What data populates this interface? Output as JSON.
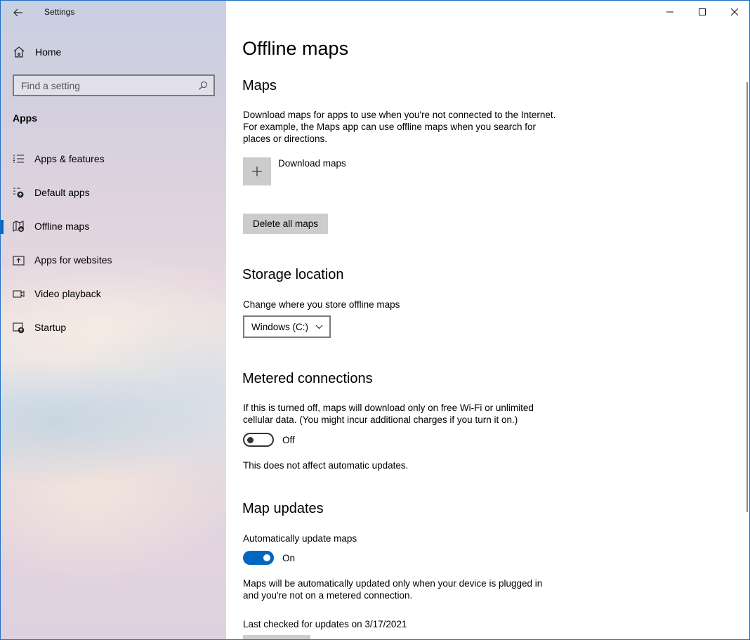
{
  "window": {
    "title": "Settings",
    "accent": "#0067c0"
  },
  "sidebar": {
    "home_label": "Home",
    "search_placeholder": "Find a setting",
    "section_label": "Apps",
    "items": [
      {
        "label": "Apps & features",
        "icon": "list-icon",
        "selected": false
      },
      {
        "label": "Default apps",
        "icon": "default-apps-icon",
        "selected": false
      },
      {
        "label": "Offline maps",
        "icon": "map-icon",
        "selected": true
      },
      {
        "label": "Apps for websites",
        "icon": "open-in-app-icon",
        "selected": false
      },
      {
        "label": "Video playback",
        "icon": "video-icon",
        "selected": false
      },
      {
        "label": "Startup",
        "icon": "startup-icon",
        "selected": false
      }
    ]
  },
  "main": {
    "title": "Offline maps",
    "maps": {
      "heading": "Maps",
      "description": "Download maps for apps to use when you're not connected to the Internet. For example, the Maps app can use offline maps when you search for places or directions.",
      "download_label": "Download maps",
      "delete_label": "Delete all maps"
    },
    "storage": {
      "heading": "Storage location",
      "description": "Change where you store offline maps",
      "selected_drive": "Windows (C:)"
    },
    "metered": {
      "heading": "Metered connections",
      "description": "If this is turned off, maps will download only on free Wi-Fi or unlimited cellular data. (You might incur additional charges if you turn it on.)",
      "toggle_state": "Off",
      "note": "This does not affect automatic updates."
    },
    "updates": {
      "heading": "Map updates",
      "description": "Automatically update maps",
      "toggle_state": "On",
      "note": "Maps will be automatically updated only when your device is plugged in and you're not on a metered connection.",
      "last_checked": "Last checked for updates on 3/17/2021"
    }
  }
}
